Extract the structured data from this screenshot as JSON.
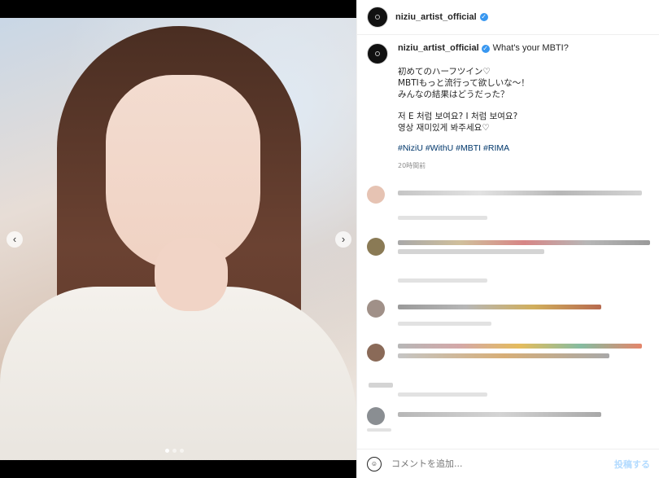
{
  "header": {
    "username": "niziu_artist_official"
  },
  "caption": {
    "username": "niziu_artist_official",
    "title": "What's your MBTI?",
    "lines_ja": [
      "初めてのハーフツイン♡",
      "MBTIもっと流行って欲しいな〜！",
      "みんなの結果はどうだった？"
    ],
    "lines_ko": [
      "저 E 처럼 보여요? I 처럼 보여요?",
      "영상 재미있게 봐주세요♡"
    ],
    "hashtags": "#NiziU #WithU #MBTI #RIMA",
    "time": "20時間前"
  },
  "footer": {
    "placeholder": "コメントを追加...",
    "post_label": "投稿する"
  },
  "icons": {
    "verified": "check-badge",
    "nav_left": "chevron-left-icon",
    "nav_right": "chevron-right-icon",
    "emoji": "smiley-icon"
  },
  "colors": {
    "verified": "#3897f0",
    "hashtag": "#00376b",
    "post_button": "#b3dbff"
  }
}
